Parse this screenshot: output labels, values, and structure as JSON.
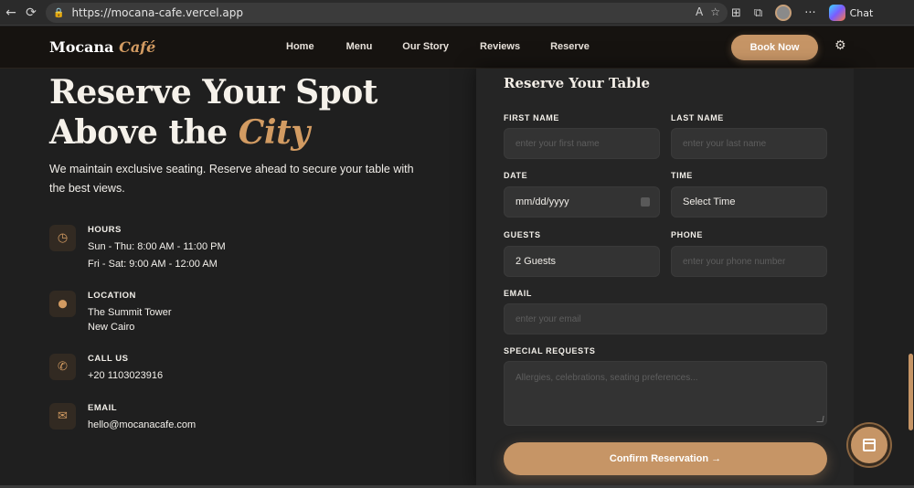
{
  "browser": {
    "back_icon": "←",
    "reload_icon": "⟳",
    "lock_icon": "🔒",
    "url": "https://mocana-cafe.vercel.app",
    "read_aloud_icon": "A",
    "favorite_icon": "☆",
    "extensions_icon": "⊞",
    "collections_icon": "⧉",
    "more_icon": "···",
    "chat_label": "Chat"
  },
  "header": {
    "logo_main": "Mocana",
    "logo_accent": "Café",
    "nav": [
      "Home",
      "Menu",
      "Our Story",
      "Reviews",
      "Reserve"
    ],
    "book_label": "Book Now",
    "settings_icon": "⚙"
  },
  "hero": {
    "line1": "Reserve Your Spot",
    "line2_prefix": "Above the",
    "line2_accent": "City",
    "lede": "We maintain exclusive seating. Reserve ahead to secure your table with the best views."
  },
  "info": {
    "hours": {
      "icon": "◷",
      "title": "HOURS",
      "lines": [
        "Sun - Thu: 8:00 AM - 11:00 PM",
        "Fri - Sat: 9:00 AM - 12:00 AM"
      ]
    },
    "location": {
      "icon": "⬤",
      "title": "LOCATION",
      "lines": [
        "The Summit Tower",
        "New Cairo"
      ]
    },
    "call": {
      "icon": "✆",
      "title": "CALL US",
      "lines": [
        "+20 1103023916"
      ]
    },
    "email": {
      "icon": "✉",
      "title": "EMAIL",
      "lines": [
        "hello@mocanacafe.com"
      ]
    }
  },
  "form": {
    "title": "Reserve Your Table",
    "first_name": {
      "label": "FIRST NAME",
      "placeholder": "enter your first name"
    },
    "last_name": {
      "label": "LAST NAME",
      "placeholder": "enter your last name"
    },
    "date": {
      "label": "DATE",
      "value": "mm/dd/yyyy"
    },
    "time": {
      "label": "TIME",
      "value": "Select Time"
    },
    "guests": {
      "label": "GUESTS",
      "value": "2 Guests"
    },
    "phone": {
      "label": "PHONE",
      "placeholder": "enter your phone number"
    },
    "email": {
      "label": "EMAIL",
      "placeholder": "enter your email"
    },
    "requests": {
      "label": "SPECIAL REQUESTS",
      "placeholder": "Allergies, celebrations, seating preferences..."
    },
    "confirm_label": "Confirm Reservation →"
  },
  "colors": {
    "accent": "#c69566",
    "background": "#1f1f1f",
    "panel": "#252525"
  }
}
